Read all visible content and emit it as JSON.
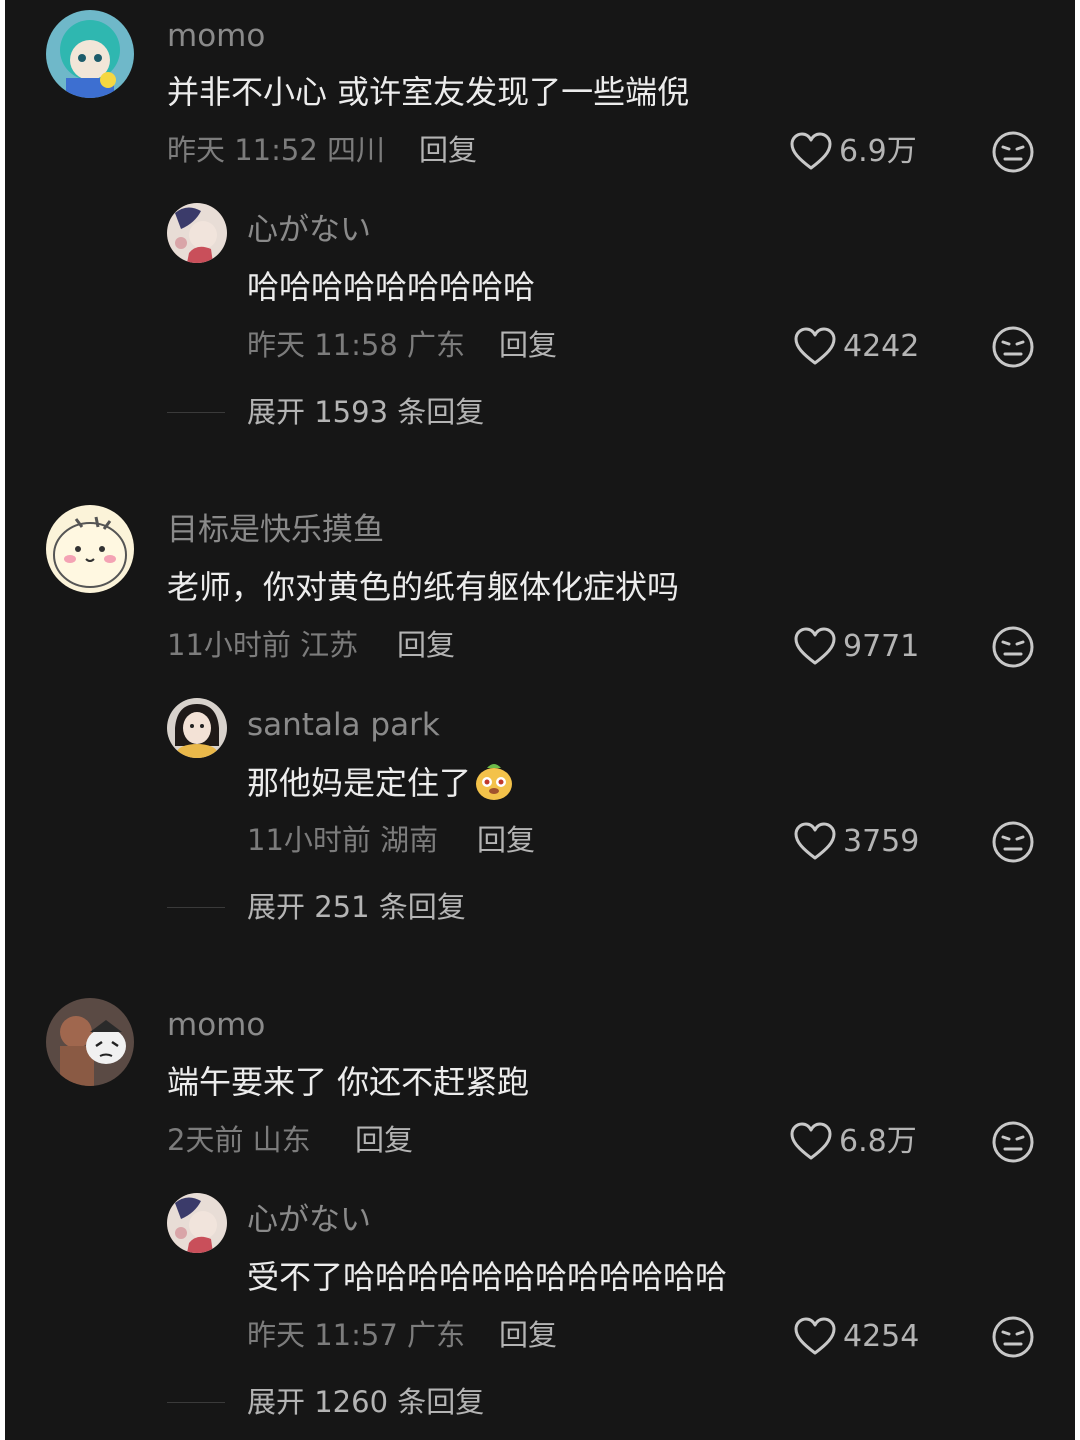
{
  "threads": [
    {
      "user": "momo",
      "text": "并非不小心 或许室友发现了一些端倪",
      "time": "昨天 11:52",
      "location": "四川",
      "reply_label": "回复",
      "likes": "6.9万",
      "reply": {
        "user": "心がない",
        "text": "哈哈哈哈哈哈哈哈哈",
        "time": "昨天 11:58",
        "location": "广东",
        "reply_label": "回复",
        "likes": "4242"
      },
      "expand_label": "展开 1593 条回复"
    },
    {
      "user": "目标是快乐摸鱼",
      "text": "老师，你对黄色的纸有躯体化症状吗",
      "time": "11小时前",
      "location": "江苏",
      "reply_label": "回复",
      "likes": "9771",
      "reply": {
        "user": "santala park",
        "text": "那他妈是定住了",
        "time": "11小时前",
        "location": "湖南",
        "reply_label": "回复",
        "likes": "3759"
      },
      "expand_label": "展开 251 条回复"
    },
    {
      "user": "momo",
      "text": "端午要来了 你还不赶紧跑",
      "time": "2天前",
      "location": "山东",
      "reply_label": "回复",
      "likes": "6.8万",
      "reply": {
        "user": "心がない",
        "text": "受不了哈哈哈哈哈哈哈哈哈哈哈哈",
        "time": "昨天 11:57",
        "location": "广东",
        "reply_label": "回复",
        "likes": "4254"
      },
      "expand_label": "展开 1260 条回复"
    }
  ],
  "colors": {
    "background": "#161616",
    "primary_text": "#ececec",
    "secondary_text": "#8a8a8a"
  },
  "icons": {
    "like": "heart-outline-icon",
    "dislike": "neutral-face-icon"
  }
}
